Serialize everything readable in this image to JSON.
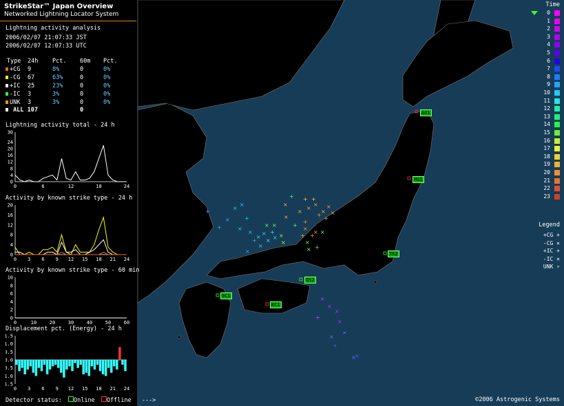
{
  "header": {
    "title": "StrikeStar™ Japan Overview",
    "subtitle": "Networked Lightning Locator System"
  },
  "analysis": {
    "heading": "Lightning activity analysis",
    "jst": "2006/02/07 21:07:33 JST",
    "utc": "2006/02/07 12:07:33 UTC"
  },
  "table": {
    "headers": [
      "Type",
      "24h",
      "Pct.",
      "60m",
      "Pct."
    ],
    "rows": [
      {
        "type": "+CG",
        "h24": "9",
        "pct24": "8%",
        "m60": "0",
        "pct60": "0%",
        "color": "#ff6a00"
      },
      {
        "type": "-CG",
        "h24": "67",
        "pct24": "63%",
        "m60": "0",
        "pct60": "0%",
        "color": "#ffff00"
      },
      {
        "type": "+IC",
        "h24": "25",
        "pct24": "23%",
        "m60": "0",
        "pct60": "0%",
        "color": "#ffffff"
      },
      {
        "type": "-IC",
        "h24": "3",
        "pct24": "3%",
        "m60": "0",
        "pct60": "0%",
        "color": "#33ff33"
      },
      {
        "type": "UNK",
        "h24": "3",
        "pct24": "3%",
        "m60": "0",
        "pct60": "0%",
        "color": "#ff9900"
      }
    ],
    "total": {
      "type": "ALL",
      "h24": "107",
      "m60": "0"
    }
  },
  "charts": {
    "total_title": "Lightning activity total - 24 h",
    "type24_title": "Activity by known strike type - 24 h",
    "type60_title": "Activity by known strike type - 60 min",
    "disp_title": "Displacement pct. (Energy) - 24 h"
  },
  "chart_data": [
    {
      "type": "line",
      "title": "Lightning activity total - 24 h",
      "xticks": [
        "0",
        "6",
        "12",
        "18",
        "24"
      ],
      "yticks": [
        "0",
        "4",
        "8",
        "12",
        "16",
        "20",
        "24",
        "30"
      ],
      "ylim": [
        0,
        30
      ],
      "x": [
        0,
        1,
        2,
        3,
        4,
        5,
        6,
        7,
        8,
        9,
        10,
        11,
        12,
        13,
        14,
        15,
        16,
        17,
        18,
        19,
        20,
        21,
        22,
        23,
        24
      ],
      "values": [
        4,
        1,
        0,
        1,
        0,
        0,
        2,
        3,
        4,
        1,
        14,
        2,
        1,
        6,
        1,
        1,
        2,
        6,
        14,
        22,
        4,
        1,
        0,
        0,
        0
      ]
    },
    {
      "type": "line",
      "title": "Activity by known strike type - 24 h",
      "xticks": [
        "0",
        "3",
        "6",
        "9",
        "12",
        "15",
        "18",
        "21",
        "24"
      ],
      "yticks": [
        "0",
        "4",
        "8",
        "12",
        "16",
        "20"
      ],
      "ylim": [
        0,
        20
      ],
      "x": [
        0,
        1,
        2,
        3,
        4,
        5,
        6,
        7,
        8,
        9,
        10,
        11,
        12,
        13,
        14,
        15,
        16,
        17,
        18,
        19,
        20,
        21,
        22,
        23,
        24
      ],
      "series": [
        {
          "color": "#ffff00",
          "values": [
            3,
            0,
            0,
            1,
            0,
            0,
            2,
            2,
            3,
            1,
            8,
            1,
            0,
            4,
            1,
            1,
            1,
            4,
            10,
            15,
            3,
            1,
            0,
            0,
            0
          ]
        },
        {
          "color": "#ffffff",
          "values": [
            1,
            1,
            0,
            0,
            0,
            0,
            0,
            1,
            1,
            0,
            5,
            1,
            1,
            2,
            0,
            0,
            1,
            2,
            4,
            6,
            1,
            0,
            0,
            0,
            0
          ]
        },
        {
          "color": "#ff6a00",
          "values": [
            0,
            0,
            0,
            0,
            0,
            0,
            0,
            0,
            0,
            0,
            1,
            0,
            0,
            0,
            0,
            0,
            0,
            0,
            0,
            1,
            0,
            0,
            0,
            0,
            0
          ]
        }
      ]
    },
    {
      "type": "line",
      "title": "Activity by known strike type - 60 min",
      "xticks": [
        "0",
        "10",
        "20",
        "30",
        "40",
        "50",
        "60"
      ],
      "yticks": [
        "0",
        "2",
        "4",
        "6",
        "8",
        "10"
      ],
      "ylim": [
        0,
        10
      ],
      "x": [
        0,
        60
      ],
      "values": [
        0,
        0
      ]
    },
    {
      "type": "bar",
      "title": "Displacement pct. (Energy) - 24 h",
      "xticks": [
        "0",
        "3",
        "6",
        "9",
        "12",
        "15",
        "18",
        "21",
        "24"
      ],
      "yticks": [
        "-1.5",
        "-1.0",
        "-0.5",
        "0.0",
        "0.5",
        "1.0",
        "1.5"
      ],
      "ylim": [
        -1.5,
        1.5
      ],
      "values": [
        -0.3,
        -0.7,
        -0.5,
        -0.9,
        -0.6,
        -0.4,
        -0.8,
        -1.0,
        -0.5,
        -0.7,
        -0.3,
        -0.9,
        -0.6,
        -0.4,
        -0.3,
        -0.5,
        -0.8,
        -1.1,
        -0.6,
        -0.4,
        -0.7,
        -0.2,
        -0.5,
        -0.3,
        -0.9,
        -0.8,
        -1.0,
        -0.4,
        -0.6,
        -0.3,
        -0.7,
        -0.9,
        -1.0,
        -0.5,
        -0.8,
        -0.4,
        -0.6,
        0.8,
        -0.3,
        -0.7
      ]
    }
  ],
  "time_legend": {
    "title": "Time",
    "rows": [
      {
        "label": "0",
        "color": "#ff00ff"
      },
      {
        "label": "1",
        "color": "#f000f5"
      },
      {
        "label": "2",
        "color": "#d400f0"
      },
      {
        "label": "3",
        "color": "#b400f0"
      },
      {
        "label": "4",
        "color": "#8a00f0"
      },
      {
        "label": "5",
        "color": "#5a00f0"
      },
      {
        "label": "6",
        "color": "#2400f0"
      },
      {
        "label": "7",
        "color": "#1c4cff"
      },
      {
        "label": "8",
        "color": "#1e7dff"
      },
      {
        "label": "9",
        "color": "#20a8ff"
      },
      {
        "label": "10",
        "color": "#22c8ff"
      },
      {
        "label": "11",
        "color": "#20e8e0"
      },
      {
        "label": "12",
        "color": "#1ef0a8"
      },
      {
        "label": "13",
        "color": "#1ef07a"
      },
      {
        "label": "14",
        "color": "#2cf044"
      },
      {
        "label": "15",
        "color": "#6ef030"
      },
      {
        "label": "16",
        "color": "#c8f030"
      },
      {
        "label": "17",
        "color": "#f0f030"
      },
      {
        "label": "18",
        "color": "#f0d030"
      },
      {
        "label": "19",
        "color": "#f0b030"
      },
      {
        "label": "20",
        "color": "#f09030"
      },
      {
        "label": "21",
        "color": "#f07030"
      },
      {
        "label": "22",
        "color": "#e05030"
      },
      {
        "label": "23",
        "color": "#d04020"
      }
    ]
  },
  "type_legend": {
    "title": "Legend",
    "rows": [
      {
        "label": "+CG",
        "symbol": "+"
      },
      {
        "label": "-CG",
        "symbol": "×"
      },
      {
        "label": "+IC",
        "symbol": "+"
      },
      {
        "label": "-IC",
        "symbol": "×"
      },
      {
        "label": "UNK",
        "symbol": "∘"
      }
    ]
  },
  "stations": [
    {
      "label": "A01",
      "status": "online"
    },
    {
      "label": "MG1",
      "status": "online"
    },
    {
      "label": "TK2",
      "status": "online"
    },
    {
      "label": "OS2",
      "status": "online"
    },
    {
      "label": "9C1",
      "status": "online"
    },
    {
      "label": "KC1",
      "status": "offline"
    }
  ],
  "footer": {
    "detector_status": "Detector status:",
    "online": "Online",
    "offline": "Offline",
    "arrow": "--->",
    "copyright": "©2006 Astrogenic Systems"
  },
  "colors": {
    "sea": "#173c57",
    "land": "#000000",
    "border": "#777777",
    "accent": "#d78a00"
  }
}
